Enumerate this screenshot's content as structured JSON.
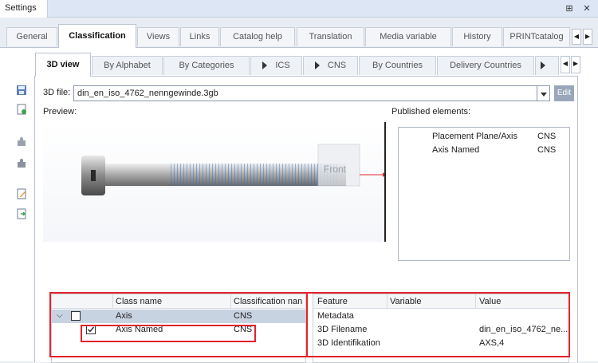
{
  "window": {
    "title": "Settings",
    "pin_glyph": "⊞",
    "close_glyph": "✕"
  },
  "main_tabs": [
    {
      "label": "General"
    },
    {
      "label": "Classification"
    },
    {
      "label": "Views"
    },
    {
      "label": "Links"
    },
    {
      "label": "Catalog help"
    },
    {
      "label": "Translation"
    },
    {
      "label": "Media variable"
    },
    {
      "label": "History"
    },
    {
      "label": "PRINTcatalog"
    }
  ],
  "sub_tabs": [
    {
      "label": "3D view"
    },
    {
      "label": "By Alphabet"
    },
    {
      "label": "By Categories"
    },
    {
      "label": "ICS"
    },
    {
      "label": "CNS"
    },
    {
      "label": "By Countries"
    },
    {
      "label": "Delivery Countries"
    }
  ],
  "file": {
    "label": "3D file:",
    "value": "din_en_iso_4762_nenngewinde.3gb",
    "edit_label": "Edit"
  },
  "preview": {
    "label": "Preview:",
    "view_cube_label": "Front",
    "more_glyph": "»"
  },
  "published": {
    "label": "Published elements:",
    "rows": [
      {
        "name": "Placement Plane/Axis",
        "type": "CNS"
      },
      {
        "name": "Axis Named",
        "type": "CNS"
      }
    ]
  },
  "class_tree": {
    "headers": {
      "name": "Class name",
      "classification": "Classification nan"
    },
    "rows": [
      {
        "name": "Axis",
        "classification": "CNS"
      },
      {
        "name": "Axis Named",
        "classification": "CNS"
      }
    ]
  },
  "feature_table": {
    "headers": {
      "feature": "Feature",
      "variable": "Variable",
      "value": "Value"
    },
    "rows": [
      {
        "feature": "Metadata",
        "variable": "",
        "value": ""
      },
      {
        "feature": "3D Filename",
        "variable": "",
        "value": "din_en_iso_4762_ne..."
      },
      {
        "feature": "3D Identifikation",
        "variable": "",
        "value": "AXS,4"
      }
    ]
  },
  "colors": {
    "highlight_red": "#e2242b",
    "selection_row": "#c8d3e2"
  }
}
